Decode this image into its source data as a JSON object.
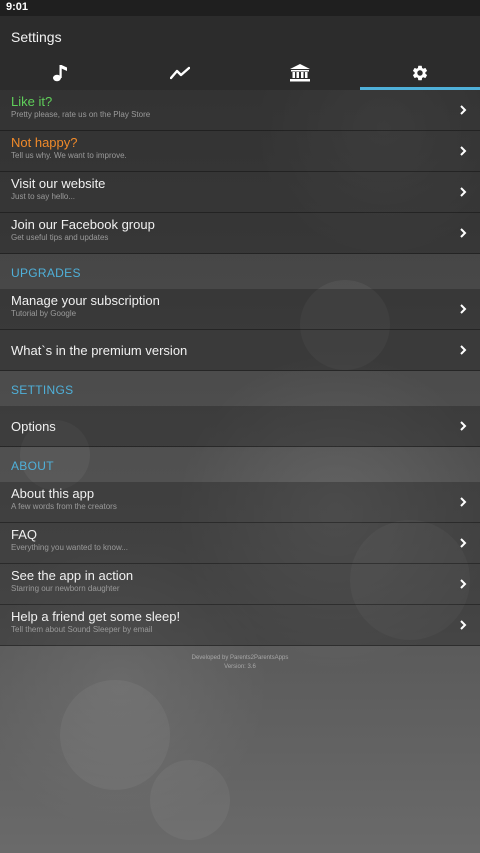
{
  "status_bar": {
    "time": "9:01"
  },
  "header": {
    "title": "Settings"
  },
  "colors": {
    "accent": "#4fb0d9",
    "like_it": "#5fcf5a",
    "not_happy": "#f08a2a"
  },
  "tabs": [
    {
      "icon": "music-note-icon",
      "active": false
    },
    {
      "icon": "chart-line-icon",
      "active": false
    },
    {
      "icon": "bank-icon",
      "active": false
    },
    {
      "icon": "gear-icon",
      "active": true
    }
  ],
  "feedback": {
    "like": {
      "title": "Like it?",
      "subtitle": "Pretty please, rate us on the Play Store"
    },
    "not_happy": {
      "title": "Not happy?",
      "subtitle": "Tell us why. We want to improve."
    },
    "website": {
      "title": "Visit our website",
      "subtitle": "Just to say hello..."
    },
    "facebook": {
      "title": "Join our Facebook group",
      "subtitle": "Get useful tips and updates"
    }
  },
  "upgrades": {
    "header": "UPGRADES",
    "subscription": {
      "title": "Manage your subscription",
      "subtitle": "Tutorial by Google"
    },
    "premium": {
      "title": "What`s in the premium version"
    }
  },
  "settings": {
    "header": "SETTINGS",
    "options": {
      "title": "Options"
    }
  },
  "about": {
    "header": "ABOUT",
    "about_app": {
      "title": "About this app",
      "subtitle": "A few words from the creators"
    },
    "faq": {
      "title": "FAQ",
      "subtitle": "Everything you wanted to know..."
    },
    "in_action": {
      "title": "See the app in action",
      "subtitle": "Starring our newborn daughter"
    },
    "help_friend": {
      "title": "Help a friend get some sleep!",
      "subtitle": "Tell them about Sound Sleeper by email"
    }
  },
  "footer": {
    "developer": "Developed by Parents2ParentsApps",
    "version": "Version: 3.6"
  }
}
